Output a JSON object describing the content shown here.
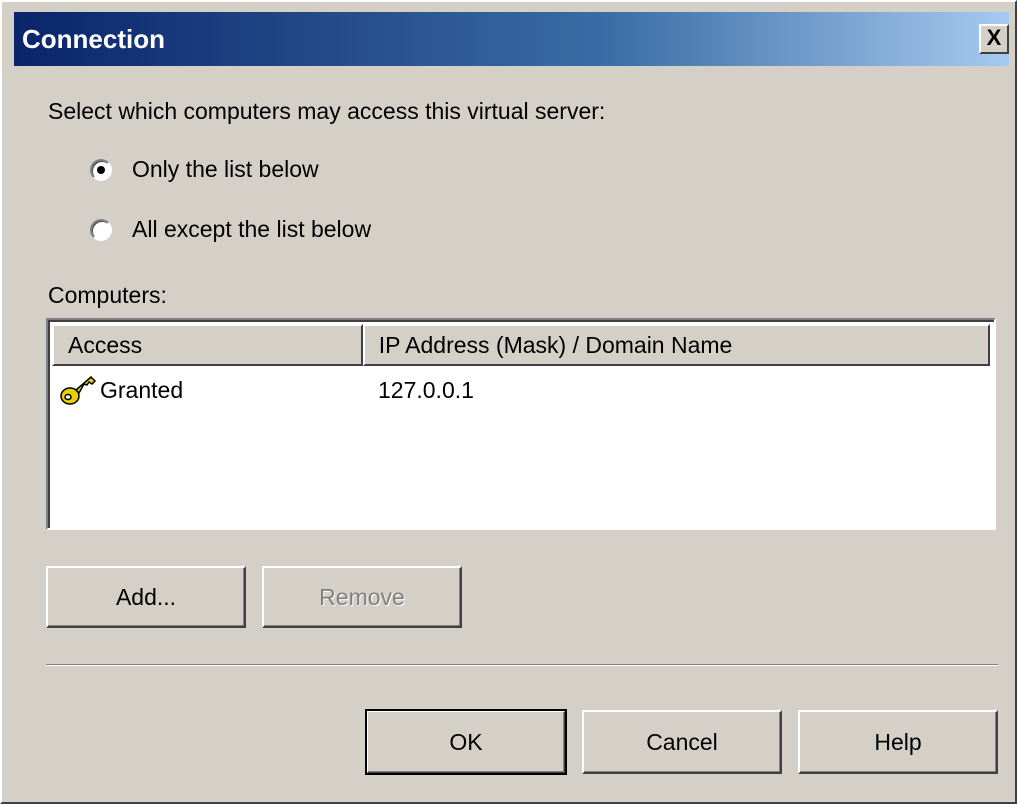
{
  "window": {
    "title": "Connection",
    "close_label": "X"
  },
  "prompt": "Select which computers may access this virtual server:",
  "radio_options": [
    {
      "label": "Only the list below",
      "selected": true
    },
    {
      "label": "All except the list below",
      "selected": false
    }
  ],
  "computers_label": "Computers:",
  "list": {
    "columns": [
      "Access",
      "IP Address (Mask) / Domain Name"
    ],
    "rows": [
      {
        "icon": "key-icon",
        "access": "Granted",
        "address": "127.0.0.1"
      }
    ]
  },
  "buttons": {
    "add": "Add...",
    "remove": "Remove",
    "ok": "OK",
    "cancel": "Cancel",
    "help": "Help"
  },
  "colors": {
    "title_bar_start": "#0a246a",
    "title_bar_end": "#a6caf0",
    "dialog_background": "#d4d0c8",
    "key_icon": "#e8d000"
  }
}
